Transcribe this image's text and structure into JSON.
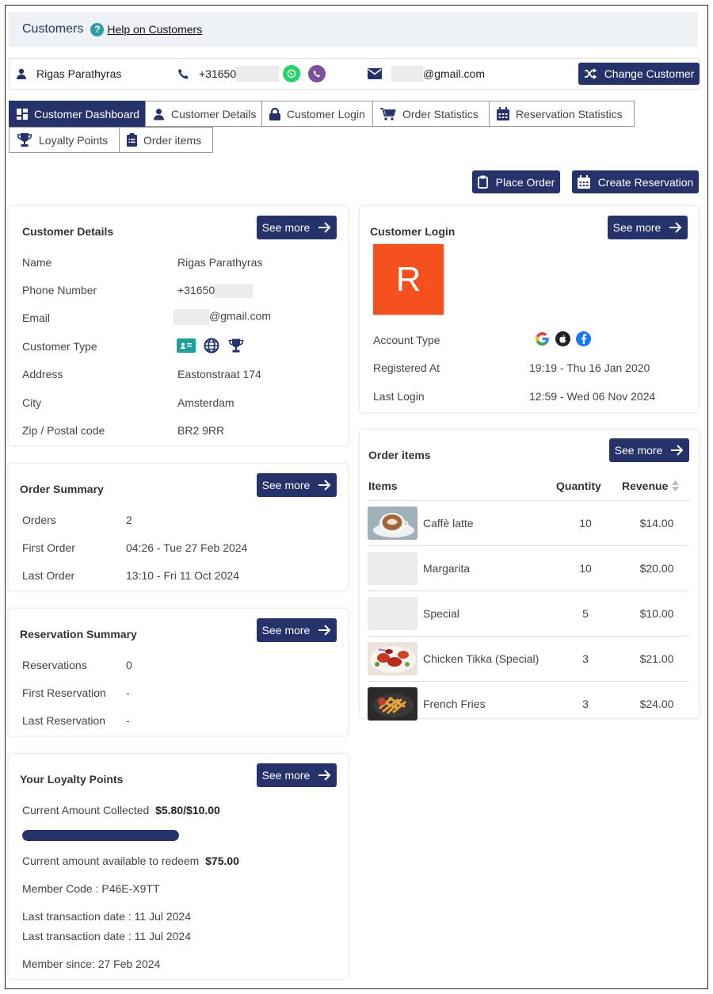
{
  "header": {
    "title": "Customers",
    "help_glyph": "?",
    "help_link": "Help on Customers"
  },
  "customer_bar": {
    "name": "Rigas Parathyras",
    "phone": "+31650",
    "email_suffix": "@gmail.com",
    "change_label": "Change Customer"
  },
  "tabs": [
    {
      "label": "Customer Dashboard",
      "active": true,
      "icon": "dashboard-icon"
    },
    {
      "label": "Customer Details",
      "active": false,
      "icon": "user-icon"
    },
    {
      "label": "Customer Login",
      "active": false,
      "icon": "lock-icon"
    },
    {
      "label": "Order Statistics",
      "active": false,
      "icon": "cart-icon"
    },
    {
      "label": "Reservation Statistics",
      "active": false,
      "icon": "calendar-icon"
    },
    {
      "label": "Loyalty Points",
      "active": false,
      "icon": "trophy-icon"
    },
    {
      "label": "Order items",
      "active": false,
      "icon": "clipboard-list-icon"
    }
  ],
  "actions": {
    "place_order": "Place Order",
    "create_reservation": "Create Reservation"
  },
  "see_more": "See more",
  "customer_details": {
    "title": "Customer Details",
    "rows": [
      {
        "label": "Name",
        "value": "Rigas Parathyras"
      },
      {
        "label": "Phone Number",
        "value": "+31650"
      },
      {
        "label": "Email",
        "value": "@gmail.com"
      },
      {
        "label": "Customer Type",
        "value": ""
      },
      {
        "label": "Address",
        "value": "Eastonstraat 174"
      },
      {
        "label": "City",
        "value": "Amsterdam"
      },
      {
        "label": "Zip / Postal code",
        "value": "BR2 9RR"
      }
    ]
  },
  "customer_login": {
    "title": "Customer Login",
    "avatar_letter": "R",
    "avatar_color": "#f4511e",
    "rows": [
      {
        "label": "Account Type",
        "value": ""
      },
      {
        "label": "Registered At",
        "value": "19:19 - Thu 16 Jan 2020"
      },
      {
        "label": "Last Login",
        "value": "12:59 - Wed 06 Nov 2024"
      }
    ]
  },
  "order_summary": {
    "title": "Order Summary",
    "rows": [
      {
        "label": "Orders",
        "value": "2"
      },
      {
        "label": "First Order",
        "value": "04:26 - Tue 27 Feb 2024"
      },
      {
        "label": "Last Order",
        "value": "13:10 - Fri 11 Oct 2024"
      }
    ]
  },
  "reservation_summary": {
    "title": "Reservation Summary",
    "rows": [
      {
        "label": "Reservations",
        "value": "0"
      },
      {
        "label": "First Reservation",
        "value": "-"
      },
      {
        "label": "Last Reservation",
        "value": "-"
      }
    ]
  },
  "order_items": {
    "title": "Order items",
    "headers": {
      "items": "Items",
      "quantity": "Quantity",
      "revenue": "Revenue"
    },
    "rows": [
      {
        "name": "Caffè latte",
        "qty": "10",
        "revenue": "$14.00",
        "thumb": "coffee"
      },
      {
        "name": "Margarita",
        "qty": "10",
        "revenue": "$20.00",
        "thumb": "none"
      },
      {
        "name": "Special",
        "qty": "5",
        "revenue": "$10.00",
        "thumb": "none"
      },
      {
        "name": "Chicken Tikka (Special)",
        "qty": "3",
        "revenue": "$21.00",
        "thumb": "tikka"
      },
      {
        "name": "French Fries",
        "qty": "3",
        "revenue": "$24.00",
        "thumb": "fries"
      }
    ]
  },
  "loyalty": {
    "title": "Your Loyalty Points",
    "collected_label": "Current Amount Collected",
    "collected_value": "$5.80/$10.00",
    "progress_fraction": 1.0,
    "redeem_label": "Current amount available to redeem",
    "redeem_value": "$75.00",
    "member_code": "Member Code : P46E-X9TT",
    "last_tx_1": "Last transaction date : 11 Jul 2024",
    "last_tx_2": "Last transaction date : 11 Jul 2024",
    "member_since": "Member since: 27 Feb 2024"
  },
  "colors": {
    "navy": "#26336a",
    "whatsapp": "#25d366",
    "viber": "#7b519d",
    "teal": "#2e9ea3"
  }
}
